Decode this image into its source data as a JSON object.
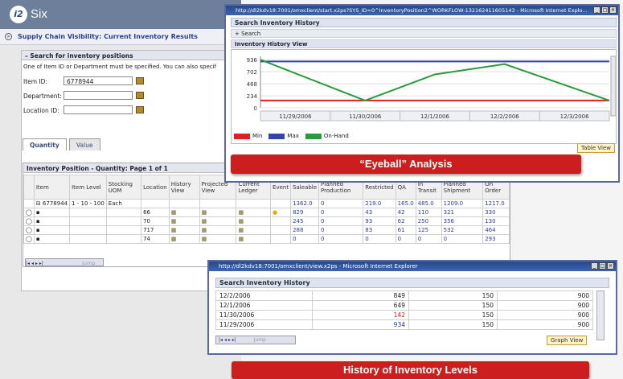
{
  "brand": {
    "logo": "i2",
    "name": "Six"
  },
  "page": {
    "title": "Supply Chain Visibility:  Current Inventory Results"
  },
  "search_panel": {
    "heading": "Search for inventory positions",
    "hint": "One of Item ID or Department must be specified. You can also specif",
    "item_id_label": "Item ID:",
    "item_id_value": "6778944",
    "department_label": "Department:",
    "location_label": "Location ID:"
  },
  "tabs": [
    {
      "label": "Quantity"
    },
    {
      "label": "Value"
    }
  ],
  "inventory": {
    "title": "Inventory Position - Quantity: Page 1 of 1",
    "columns": [
      "Item",
      "Item Level",
      "Stocking UOM",
      "Location",
      "History View",
      "Projected View",
      "Current Ledger",
      "Event",
      "Saleable",
      "Planned Production",
      "Restricted",
      "QA",
      "In Transit",
      "Planned Shipment",
      "On Order"
    ],
    "summary_row": {
      "item": "6778944",
      "level": "1 - 10 - 100",
      "uom": "Each",
      "saleable": "1362.0",
      "planned_production": "0",
      "restricted": "219.0",
      "qa": "165.0",
      "in_transit": "485.0",
      "planned_shipment": "1209.0",
      "on_order": "1217.0"
    },
    "rows": [
      {
        "location": "66",
        "saleable": "829",
        "planned_production": "0",
        "restricted": "43",
        "qa": "42",
        "in_transit": "110",
        "planned_shipment": "321",
        "on_order": "330"
      },
      {
        "location": "70",
        "saleable": "245",
        "planned_production": "0",
        "restricted": "93",
        "qa": "62",
        "in_transit": "250",
        "planned_shipment": "356",
        "on_order": "130"
      },
      {
        "location": "717",
        "saleable": "288",
        "planned_production": "0",
        "restricted": "83",
        "qa": "61",
        "in_transit": "125",
        "planned_shipment": "532",
        "on_order": "464"
      },
      {
        "location": "74",
        "saleable": "0",
        "planned_production": "0",
        "restricted": "0",
        "qa": "0",
        "in_transit": "0",
        "planned_shipment": "0",
        "on_order": "293"
      }
    ],
    "jump_label": "Jump"
  },
  "popup_top": {
    "title": "http://dl2kdv18:7001/omxclient/start.x2ps?SYS_ID=0^InventoryPosition2^WORKFLOW-132162411605143 - Microsoft Internet Explo...",
    "section": "Search Inventory History",
    "search_toggle": "+ Search",
    "view_title": "Inventory History View",
    "table_view_button": "Table View",
    "banner": "“Eyeball” Analysis"
  },
  "chart_data": {
    "type": "line",
    "x": [
      "11/29/2006",
      "11/30/2006",
      "12/1/2006",
      "12/2/2006",
      "12/3/2006"
    ],
    "yticks": [
      0,
      234,
      468,
      702,
      936
    ],
    "ylim": [
      0,
      1000
    ],
    "series": [
      {
        "name": "Min",
        "color": "#e02020",
        "values": [
          142,
          142,
          142,
          142,
          142
        ]
      },
      {
        "name": "Max",
        "color": "#3344aa",
        "values": [
          900,
          900,
          900,
          900,
          900
        ]
      },
      {
        "name": "On-Hand",
        "color": "#2a9a3a",
        "values": [
          934,
          142,
          649,
          849,
          142
        ]
      }
    ],
    "legend": "bottom-left"
  },
  "popup_bottom": {
    "title": "http://dl2kdv18:7001/omxclient/view.x2ps - Microsoft Internet Explorer",
    "section": "Search Inventory History",
    "rows": [
      {
        "date": "12/2/2006",
        "onhand": "849",
        "min": "150",
        "max": "900"
      },
      {
        "date": "12/1/2006",
        "onhand": "649",
        "min": "150",
        "max": "900"
      },
      {
        "date": "11/30/2006",
        "onhand": "142",
        "min": "150",
        "max": "900"
      },
      {
        "date": "11/29/2006",
        "onhand": "934",
        "min": "150",
        "max": "900"
      }
    ],
    "jump_label": "Jump",
    "graph_view_button": "Graph View",
    "banner": "History of Inventory Levels"
  }
}
